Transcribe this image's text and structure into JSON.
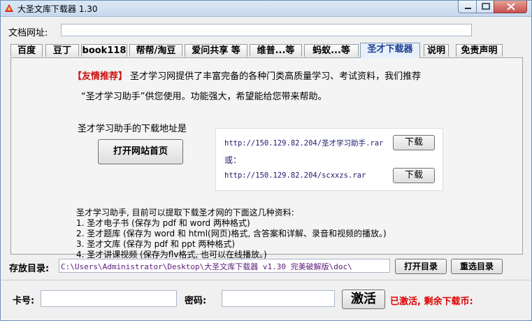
{
  "window": {
    "title": "大圣文库下载器 1.30",
    "icon": "app-logo-icon"
  },
  "url_bar": {
    "label": "文档网址:",
    "value": ""
  },
  "tabs": [
    {
      "label": "百度"
    },
    {
      "label": "豆丁"
    },
    {
      "label": "book118"
    },
    {
      "label": "帮帮/淘豆"
    },
    {
      "label": "爱问共享 等"
    },
    {
      "label": "维普...等"
    },
    {
      "label": "蚂蚁...等"
    },
    {
      "label": "圣才下载器",
      "active": true
    },
    {
      "label": "说明"
    },
    {
      "label": "免责声明"
    }
  ],
  "panel": {
    "promo_tag": "【友情推荐】",
    "promo_line1": " 圣才学习网提供了丰富完备的各种门类高质量学习、考试资料，我们推荐",
    "promo_line2": "“圣才学习助手”供您使用。功能强大，希望能给您带来帮助。",
    "download_label": "圣才学习助手的下载地址是",
    "open_site_button": "打开网站首页",
    "link1": "http://150.129.82.204/圣才学习助手.rar",
    "or": "或：",
    "link2": "http://150.129.82.204/scxxzs.rar",
    "download_button": "下载",
    "features": [
      "圣才学习助手, 目前可以提取下载圣才网的下面这几种资料:",
      "1. 圣才电子书 (保存为 pdf 和 word 两种格式)",
      "2. 圣才题库 (保存为 word 和 html(网页)格式, 含答案和详解、录音和视频的播放。)",
      "3. 圣才文库 (保存为 pdf 和 ppt 两种格式)",
      "4. 圣才讲课视频 (保存为flv格式, 也可以在线播放。)"
    ]
  },
  "save": {
    "label": "存放目录:",
    "path": "C:\\Users\\Administrator\\Desktop\\大圣文库下载器 v1.30 完美破解版\\doc\\",
    "open_dir_button": "打开目录",
    "reselect_dir_button": "重选目录"
  },
  "activation": {
    "card_label": "卡号:",
    "card_value": "",
    "password_label": "密码:",
    "password_value": "",
    "activate_button": "激活",
    "status": "已激活, 剩余下载币:"
  },
  "colors": {
    "accent": "#1a3f8f",
    "promo_red": "#c81010",
    "status_red": "#e00000",
    "path_purple": "#5a1a7a"
  }
}
